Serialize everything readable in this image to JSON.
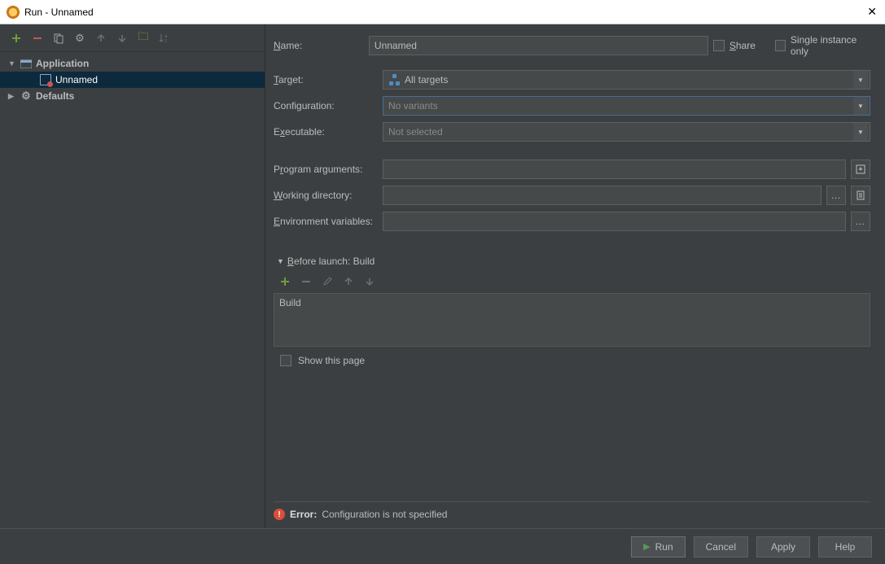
{
  "titlebar": {
    "title": "Run - Unnamed"
  },
  "sidebar": {
    "items": [
      {
        "label": "Application",
        "expanded": true,
        "bold": true
      },
      {
        "label": "Unnamed",
        "selected": true,
        "indent": true
      },
      {
        "label": "Defaults",
        "expanded": false,
        "bold": true
      }
    ]
  },
  "form": {
    "name_label": "Name:",
    "name_value": "Unnamed",
    "share_label": "Share",
    "single_instance_label": "Single instance only",
    "target_label": "Target:",
    "target_value": "All targets",
    "config_label": "Configuration:",
    "config_value": "No variants",
    "exec_label": "Executable:",
    "exec_value": "Not selected",
    "progargs_label": "Program arguments:",
    "workdir_label": "Working directory:",
    "envvars_label": "Environment variables:"
  },
  "before_launch": {
    "header": "Before launch: Build",
    "tasks": [
      "Build"
    ],
    "show_page_label": "Show this page"
  },
  "error": {
    "label": "Error:",
    "message": "Configuration is not specified"
  },
  "footer": {
    "run": "Run",
    "cancel": "Cancel",
    "apply": "Apply",
    "help": "Help"
  }
}
